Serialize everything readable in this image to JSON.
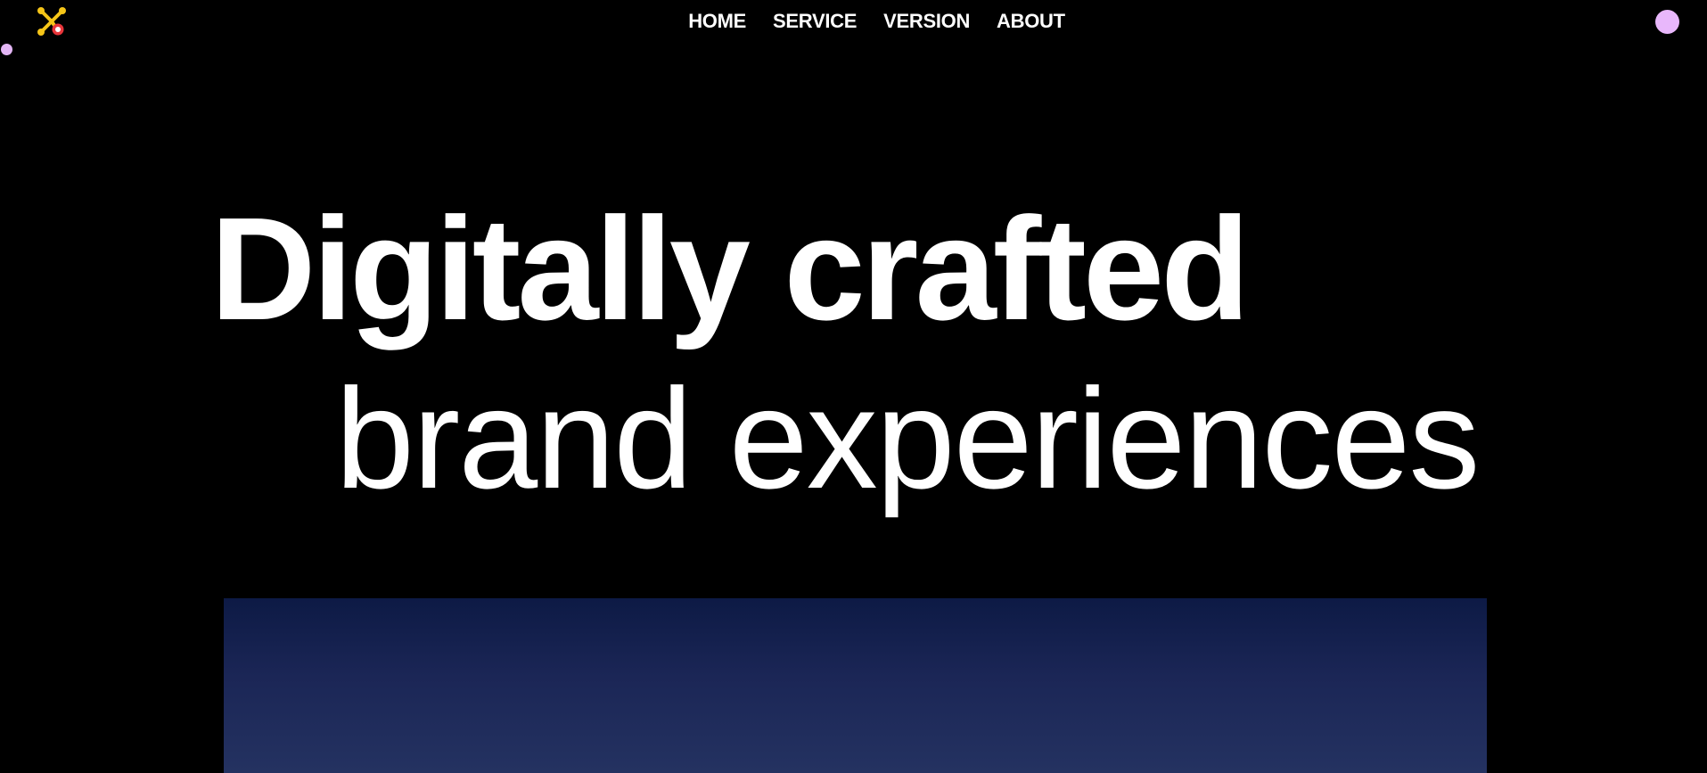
{
  "brand": {
    "logo_icon": "molecule-logo-icon",
    "colors": {
      "logo_yellow": "#f5c518",
      "logo_red": "#e8353a",
      "cursor_pink": "#e8b7fb",
      "hero_panel_top": "#0d1a45",
      "hero_panel_bottom": "#243261"
    }
  },
  "nav": {
    "items": [
      {
        "label": "HOME"
      },
      {
        "label": "SERVICE"
      },
      {
        "label": "VERSION"
      },
      {
        "label": "ABOUT"
      }
    ]
  },
  "hero": {
    "line1": "Digitally crafted",
    "line2": "brand experiences"
  }
}
